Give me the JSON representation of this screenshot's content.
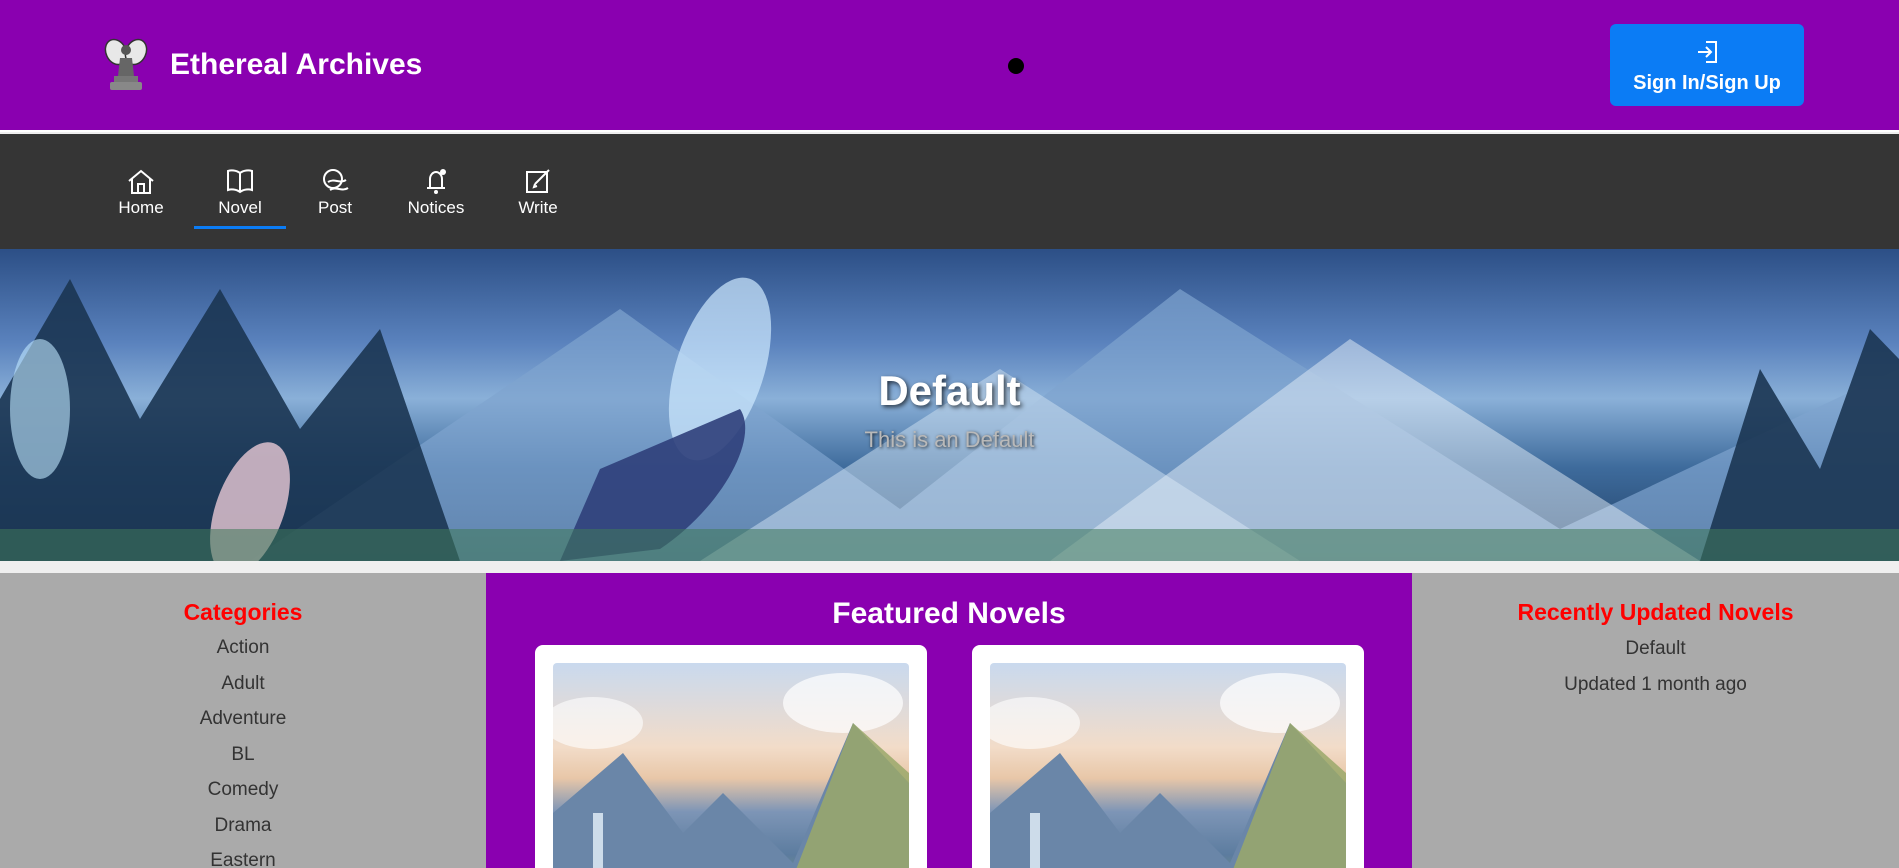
{
  "header": {
    "site_title": "Ethereal Archives",
    "auth_button_label": "Sign In/Sign Up",
    "background_color": "#8a00b0",
    "button_color": "#0b7cf5"
  },
  "nav": {
    "items": [
      {
        "label": "Home",
        "icon": "home-icon"
      },
      {
        "label": "Novel",
        "icon": "book-icon",
        "active": true
      },
      {
        "label": "Post",
        "icon": "post-icon"
      },
      {
        "label": "Notices",
        "icon": "bell-icon"
      },
      {
        "label": "Write",
        "icon": "edit-icon"
      }
    ],
    "background_color": "#353535"
  },
  "hero": {
    "title": "Default",
    "subtitle": "This is an Default"
  },
  "categories": {
    "heading": "Categories",
    "items": [
      "Action",
      "Adult",
      "Adventure",
      "BL",
      "Comedy",
      "Drama",
      "Eastern"
    ]
  },
  "featured": {
    "heading": "Featured Novels",
    "cards": [
      {
        "image": "novel-cover-image"
      },
      {
        "image": "novel-cover-image"
      }
    ]
  },
  "recent": {
    "heading": "Recently Updated Novels",
    "items": [
      {
        "title": "Default",
        "updated": "Updated 1 month ago"
      }
    ]
  },
  "colors": {
    "accent": "#8a00b0",
    "heading_red": "#ff0000",
    "sidebar_gray": "#aaaaaa"
  }
}
